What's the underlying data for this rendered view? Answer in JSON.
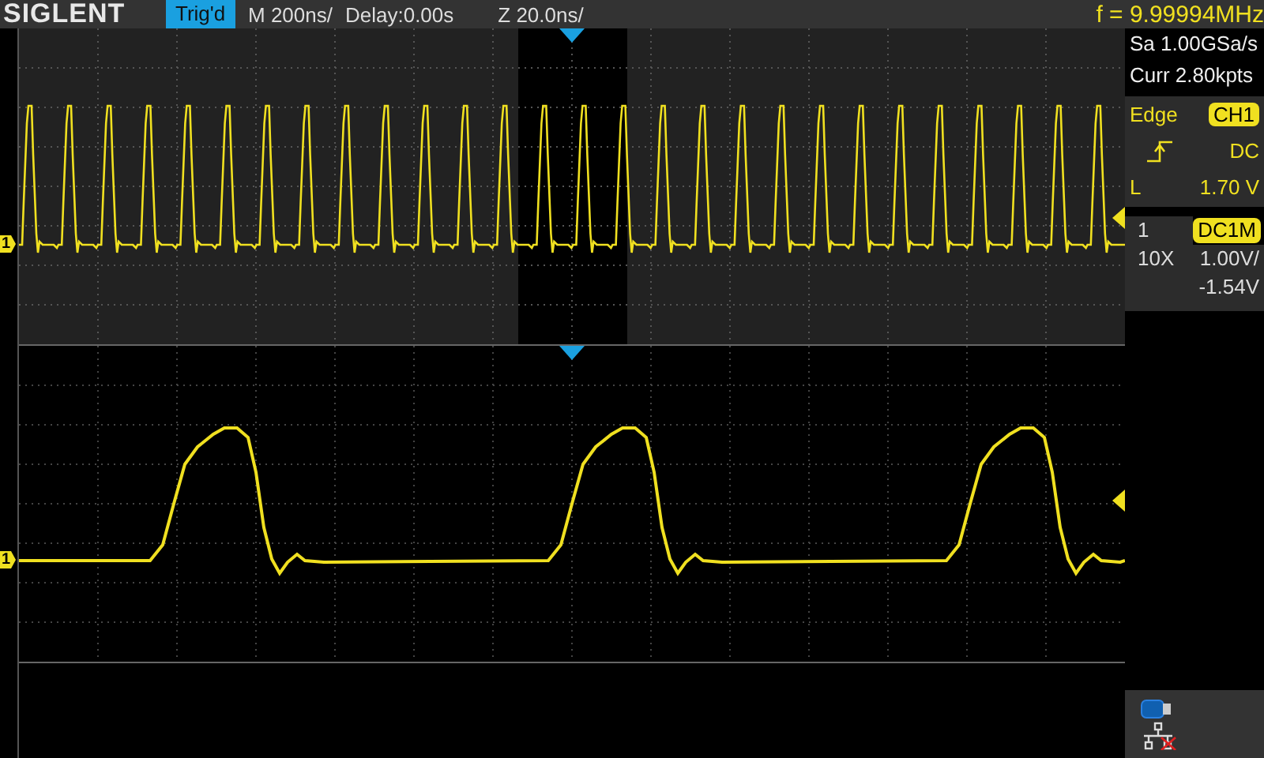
{
  "brand": "SIGLENT",
  "trigger_status": "Trig'd",
  "timebase": "M 200ns/",
  "delay": "Delay:0.00s",
  "zoom_timebase": "Z 20.0ns/",
  "frequency": "f = 9.99994MHz",
  "channel_markers": [
    "1",
    "1"
  ],
  "acquisition": {
    "sample_rate": "Sa 1.00GSa/s",
    "memory_depth": "Curr 2.80kpts"
  },
  "trigger": {
    "type": "Edge",
    "source": "CH1",
    "coupling": "DC",
    "level_label": "L",
    "level_value": "1.70 V"
  },
  "channel": {
    "number": "1",
    "coupling": "DC1M",
    "probe": "10X",
    "scale": "1.00V/",
    "offset": "-1.54V"
  },
  "network": {
    "connected": false
  }
}
